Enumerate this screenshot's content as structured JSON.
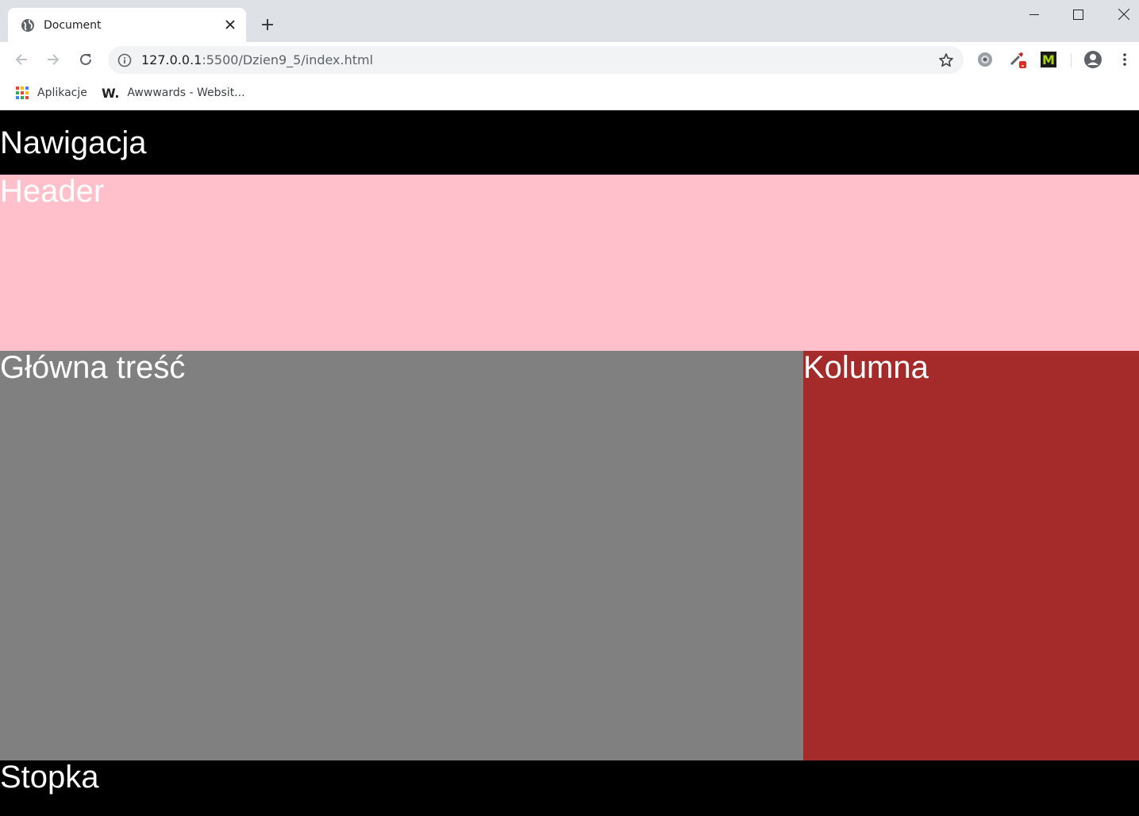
{
  "browser": {
    "tab": {
      "title": "Document",
      "favicon": "globe-icon"
    },
    "address": {
      "host": "127.0.0.1",
      "path": ":5500/Dzien9_5/index.html"
    },
    "bookmarks": [
      {
        "label": "Aplikacje",
        "icon": "apps-grid-icon"
      },
      {
        "label": "Awwwards - Websit...",
        "icon": "awwwards-w-icon"
      }
    ],
    "extensions": [
      "settings-extension-icon",
      "eyedropper-extension-icon",
      "m-extension-icon",
      "profile-icon",
      "menu-kebab-icon"
    ]
  },
  "page": {
    "nav": {
      "label": "Nawigacja",
      "color": "#000000"
    },
    "header": {
      "label": "Header",
      "color": "#ffc0cb"
    },
    "main": {
      "label": "Główna treść",
      "color": "#808080"
    },
    "aside": {
      "label": "Kolumna",
      "color": "#a52a2a"
    },
    "footer": {
      "label": "Stopka",
      "color": "#000000"
    }
  }
}
